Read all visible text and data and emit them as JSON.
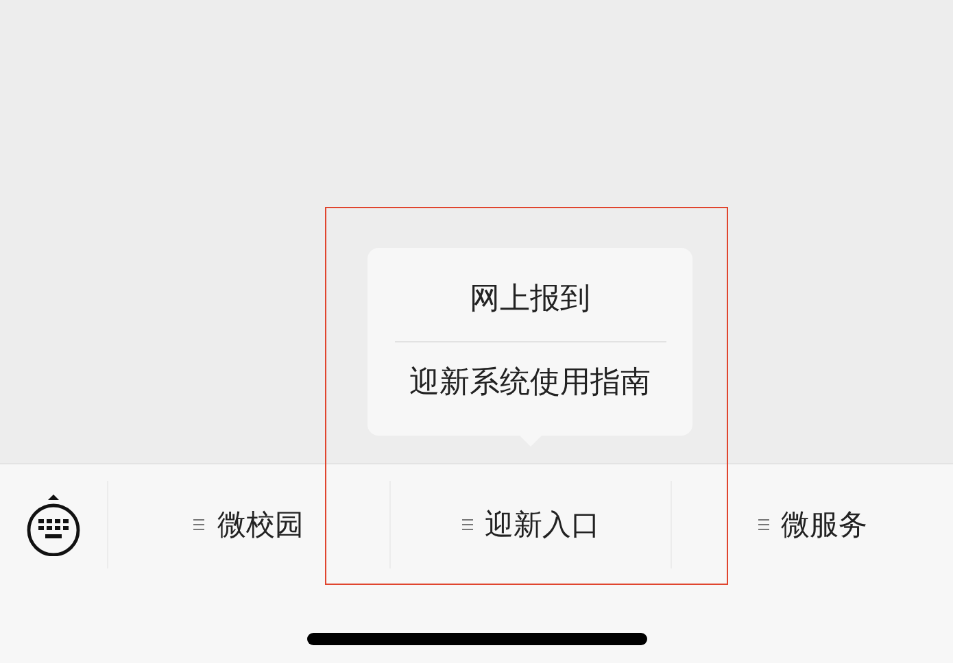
{
  "menu": {
    "items": [
      {
        "label": "微校园"
      },
      {
        "label": "迎新入口",
        "submenu": [
          "网上报到",
          "迎新系统使用指南"
        ]
      },
      {
        "label": "微服务"
      }
    ]
  }
}
